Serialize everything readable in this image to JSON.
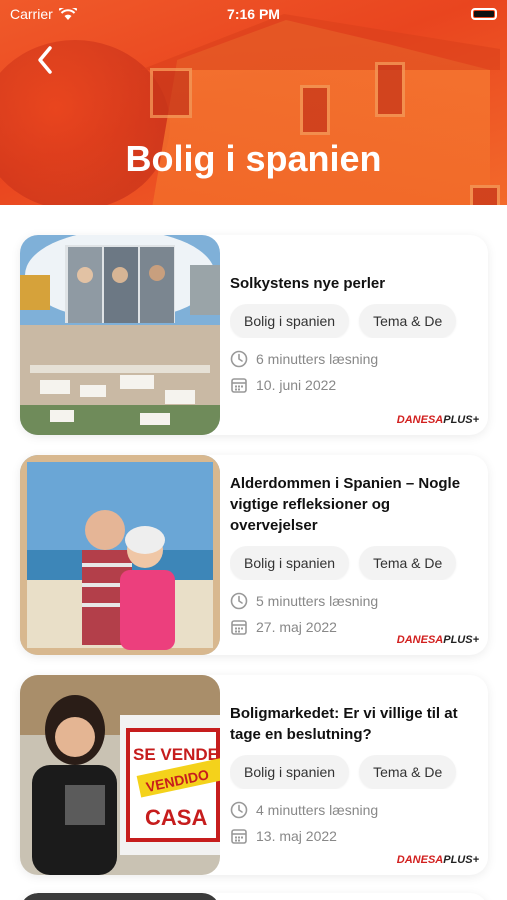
{
  "status": {
    "carrier": "Carrier",
    "time": "7:16 PM"
  },
  "header": {
    "title": "Bolig i spanien"
  },
  "articles": [
    {
      "title": "Solkystens nye perler",
      "tags": [
        "Bolig i spanien",
        "Tema & De"
      ],
      "read_time": "6 minutters læsning",
      "date": "10. juni 2022",
      "brand": "DANESA",
      "brand_suffix": "PLUS+"
    },
    {
      "title": "Alderdommen i Spanien – Nogle vigtige refleksioner og overvejelser",
      "tags": [
        "Bolig i spanien",
        "Tema & De"
      ],
      "read_time": "5 minutters læsning",
      "date": "27. maj 2022",
      "brand": "DANESA",
      "brand_suffix": "PLUS+"
    },
    {
      "title": "Boligmarkedet: Er vi villige til at tage en beslutning?",
      "tags": [
        "Bolig i spanien",
        "Tema & De"
      ],
      "read_time": "4 minutters læsning",
      "date": "13. maj 2022",
      "brand": "DANESA",
      "brand_suffix": "PLUS+"
    }
  ],
  "sign_text": {
    "line1": "SE VENDE",
    "line2": "VENDIDO",
    "line3": "CASA"
  }
}
